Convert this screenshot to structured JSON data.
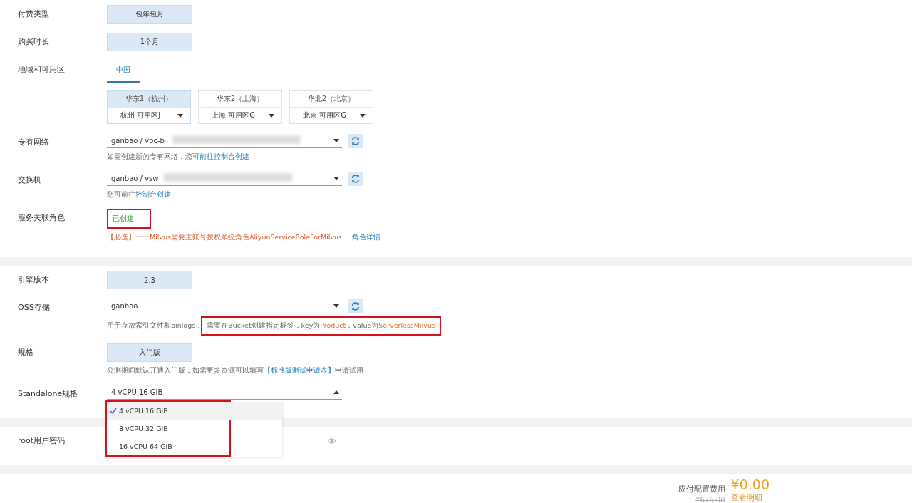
{
  "sections": [
    {
      "rows": [
        {
          "kind": "button",
          "label": "付费类型",
          "value": "包年包月"
        },
        {
          "kind": "button",
          "label": "购买时长",
          "value": "1个月"
        },
        {
          "kind": "region",
          "label": "地域和可用区",
          "tabs": [
            {
              "label": "中国",
              "selected": true
            }
          ],
          "zones": [
            {
              "region": "华东1（杭州）",
              "zone": "杭州 可用区J",
              "selected": true
            },
            {
              "region": "华东2（上海）",
              "zone": "上海 可用区G",
              "selected": false
            },
            {
              "region": "华北2（北京）",
              "zone": "北京 可用区G",
              "selected": false
            }
          ]
        },
        {
          "kind": "select",
          "label": "专有网络",
          "value": "ganbao / vpc-b",
          "redacted": true,
          "refresh": true,
          "hints": [
            {
              "highlighted": false,
              "parts": [
                {
                  "kind": "plain",
                  "text": "如需创建新的专有网络，您可"
                },
                {
                  "kind": "link",
                  "text": "前往控制台创建"
                }
              ]
            }
          ]
        },
        {
          "kind": "select",
          "label": "交换机",
          "value": "ganbao / vsw",
          "redacted": true,
          "refresh": true,
          "hints": [
            {
              "highlighted": false,
              "parts": [
                {
                  "kind": "plain",
                  "text": "您可前往"
                },
                {
                  "kind": "link",
                  "text": "控制台创建"
                }
              ]
            }
          ]
        },
        {
          "kind": "status",
          "label": "服务关联角色",
          "status": "已创建",
          "highlighted": true,
          "hints": [
            {
              "highlighted": false,
              "parts": [
                {
                  "kind": "warn",
                  "text": "【必选】一一Milvus需要主账号授权系统角色AliyunServiceRoleForMilvus"
                },
                {
                  "kind": "link",
                  "text": "角色详情"
                }
              ]
            }
          ]
        }
      ]
    },
    {
      "rows": [
        {
          "kind": "button",
          "label": "引擎版本",
          "value": "2.3"
        },
        {
          "kind": "select",
          "label": "OSS存储",
          "value": "ganbao",
          "refresh": true,
          "hints": [
            {
              "highlighted": false,
              "parts": [
                {
                  "kind": "plain",
                  "text": "用于存放索引文件和binlogs，"
                }
              ]
            },
            {
              "highlighted": true,
              "parts": [
                {
                  "kind": "plain",
                  "text": "需要在Bucket创建指定标签，key为"
                },
                {
                  "kind": "accent",
                  "text": "Product"
                },
                {
                  "kind": "plain",
                  "text": "，value为"
                },
                {
                  "kind": "accent",
                  "text": "ServerlessMilvus"
                }
              ]
            }
          ]
        },
        {
          "kind": "button",
          "label": "规格",
          "value": "入门版",
          "hints": [
            {
              "highlighted": false,
              "parts": [
                {
                  "kind": "plain",
                  "text": "公测期间默认开通入门版，如需更多资源可以填写"
                },
                {
                  "kind": "link",
                  "text": "【标准版测试申请表】"
                },
                {
                  "kind": "plain",
                  "text": "申请试用"
                }
              ]
            }
          ]
        },
        {
          "kind": "select",
          "label": "Standalone规格",
          "value": "4 vCPU 16 GiB",
          "open": true,
          "options": [
            {
              "label": "4 vCPU 16 GiB",
              "selected": true
            },
            {
              "label": "8 vCPU 32 GiB",
              "selected": false
            },
            {
              "label": "16 vCPU 64 GiB",
              "selected": false
            }
          ],
          "options_highlighted": true
        }
      ]
    },
    {
      "rows": [
        {
          "kind": "password",
          "label": "root用户密码"
        }
      ]
    }
  ],
  "footer": {
    "label": "应付配置费用",
    "price": "¥0.00",
    "original_price": "¥676.00",
    "link": "查看明细"
  }
}
